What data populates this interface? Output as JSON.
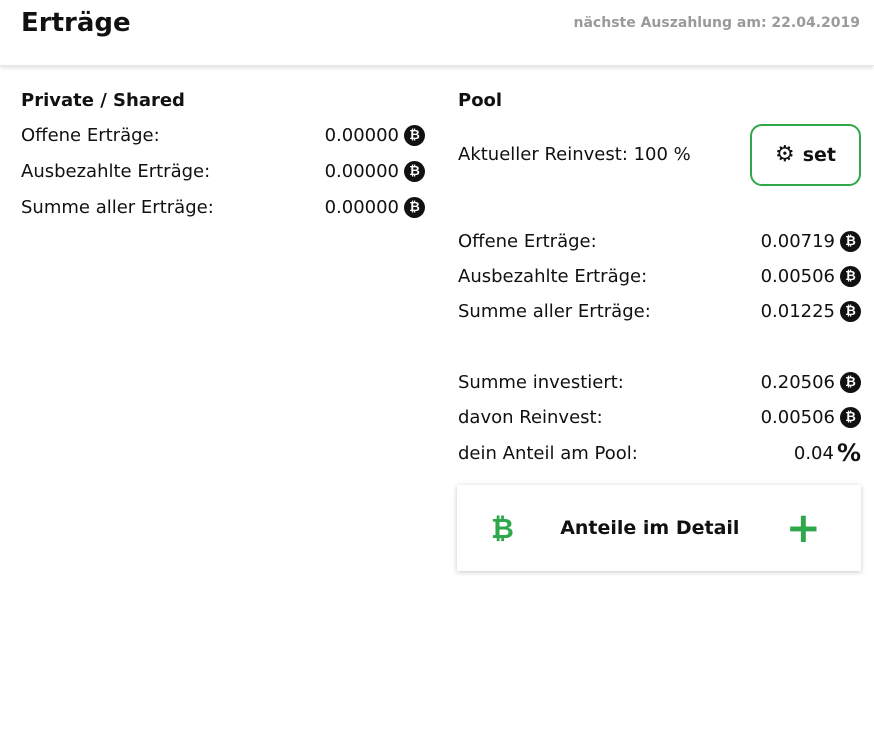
{
  "header": {
    "title": "Erträge",
    "next_payout": "nächste Auszahlung am: 22.04.2019"
  },
  "private": {
    "title": "Private / Shared",
    "rows": [
      {
        "label": "Offene Erträge:",
        "value": "0.00000"
      },
      {
        "label": "Ausbezahlte Erträge:",
        "value": "0.00000"
      },
      {
        "label": "Summe aller Erträge:",
        "value": "0.00000"
      }
    ]
  },
  "pool": {
    "title": "Pool",
    "reinvest_label": "Aktueller Reinvest: 100 %",
    "set_button": "set",
    "earnings": [
      {
        "label": "Offene Erträge:",
        "value": "0.00719"
      },
      {
        "label": "Ausbezahlte Erträge:",
        "value": "0.00506"
      },
      {
        "label": "Summe aller Erträge:",
        "value": "0.01225"
      }
    ],
    "investment": [
      {
        "label": "Summe investiert:",
        "value": "0.20506"
      },
      {
        "label": "davon Reinvest:",
        "value": "0.00506"
      }
    ],
    "share": {
      "label": "dein Anteil am Pool:",
      "value": "0.04",
      "unit": "%"
    },
    "detail_card": {
      "label": "Anteile im Detail"
    }
  },
  "icons": {
    "currency": "bitcoin-icon",
    "settings": "gear-icon",
    "expand": "plus-icon"
  },
  "colors": {
    "accent": "#2ea84a",
    "muted_text": "#9a9a9a",
    "text": "#111111"
  }
}
